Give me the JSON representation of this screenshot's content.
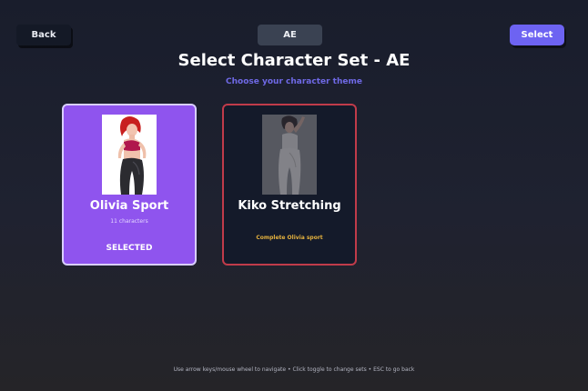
{
  "header": {
    "back_label": "Back",
    "toggle_label": "AE",
    "select_label": "Select"
  },
  "title": "Select Character Set - AE",
  "subtitle": "Choose your character theme",
  "cards": [
    {
      "name": "Olivia Sport",
      "count": "11 characters",
      "status": "SELECTED",
      "selected": true,
      "accent": "#8f54ee"
    },
    {
      "name": "Kiko Stretching",
      "requirement": "Complete Olivia sport",
      "selected": false,
      "accent": "#c03b4a"
    }
  ],
  "footer_hint": "Use arrow keys/mouse wheel to navigate • Click toggle to change sets • ESC to go back",
  "colors": {
    "accent": "#6d63f2",
    "selected_card": "#8f54ee",
    "locked_border": "#c03b4a",
    "lock_text": "#e4b13e"
  }
}
